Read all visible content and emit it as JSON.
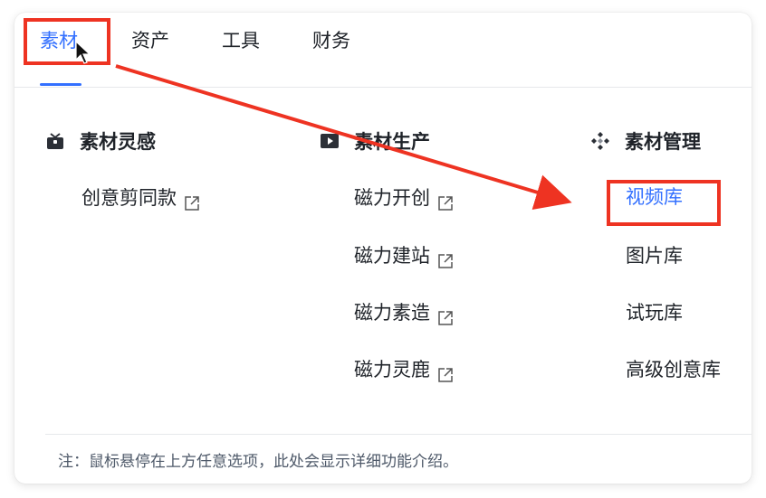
{
  "tabs": [
    {
      "label": "素材",
      "active": true
    },
    {
      "label": "资产",
      "active": false
    },
    {
      "label": "工具",
      "active": false
    },
    {
      "label": "财务",
      "active": false
    }
  ],
  "columns": [
    {
      "title": "素材灵感",
      "icon": "gift-box-icon",
      "items": [
        {
          "label": "创意剪同款",
          "external": true
        }
      ]
    },
    {
      "title": "素材生产",
      "icon": "play-icon",
      "items": [
        {
          "label": "磁力开创",
          "external": true
        },
        {
          "label": "磁力建站",
          "external": true
        },
        {
          "label": "磁力素造",
          "external": true
        },
        {
          "label": "磁力灵鹿",
          "external": true
        }
      ]
    },
    {
      "title": "素材管理",
      "icon": "diamond-grid-icon",
      "items": [
        {
          "label": "视频库",
          "external": false,
          "highlighted": true
        },
        {
          "label": "图片库",
          "external": false
        },
        {
          "label": "试玩库",
          "external": false
        },
        {
          "label": "高级创意库",
          "external": false
        }
      ]
    }
  ],
  "footer": {
    "note": "注：鼠标悬停在上方任意选项，此处会显示详细功能介绍。"
  },
  "colors": {
    "accent": "#3370ff",
    "annotation": "#ee3322",
    "text": "#1f2329",
    "muted": "#4e5969"
  }
}
